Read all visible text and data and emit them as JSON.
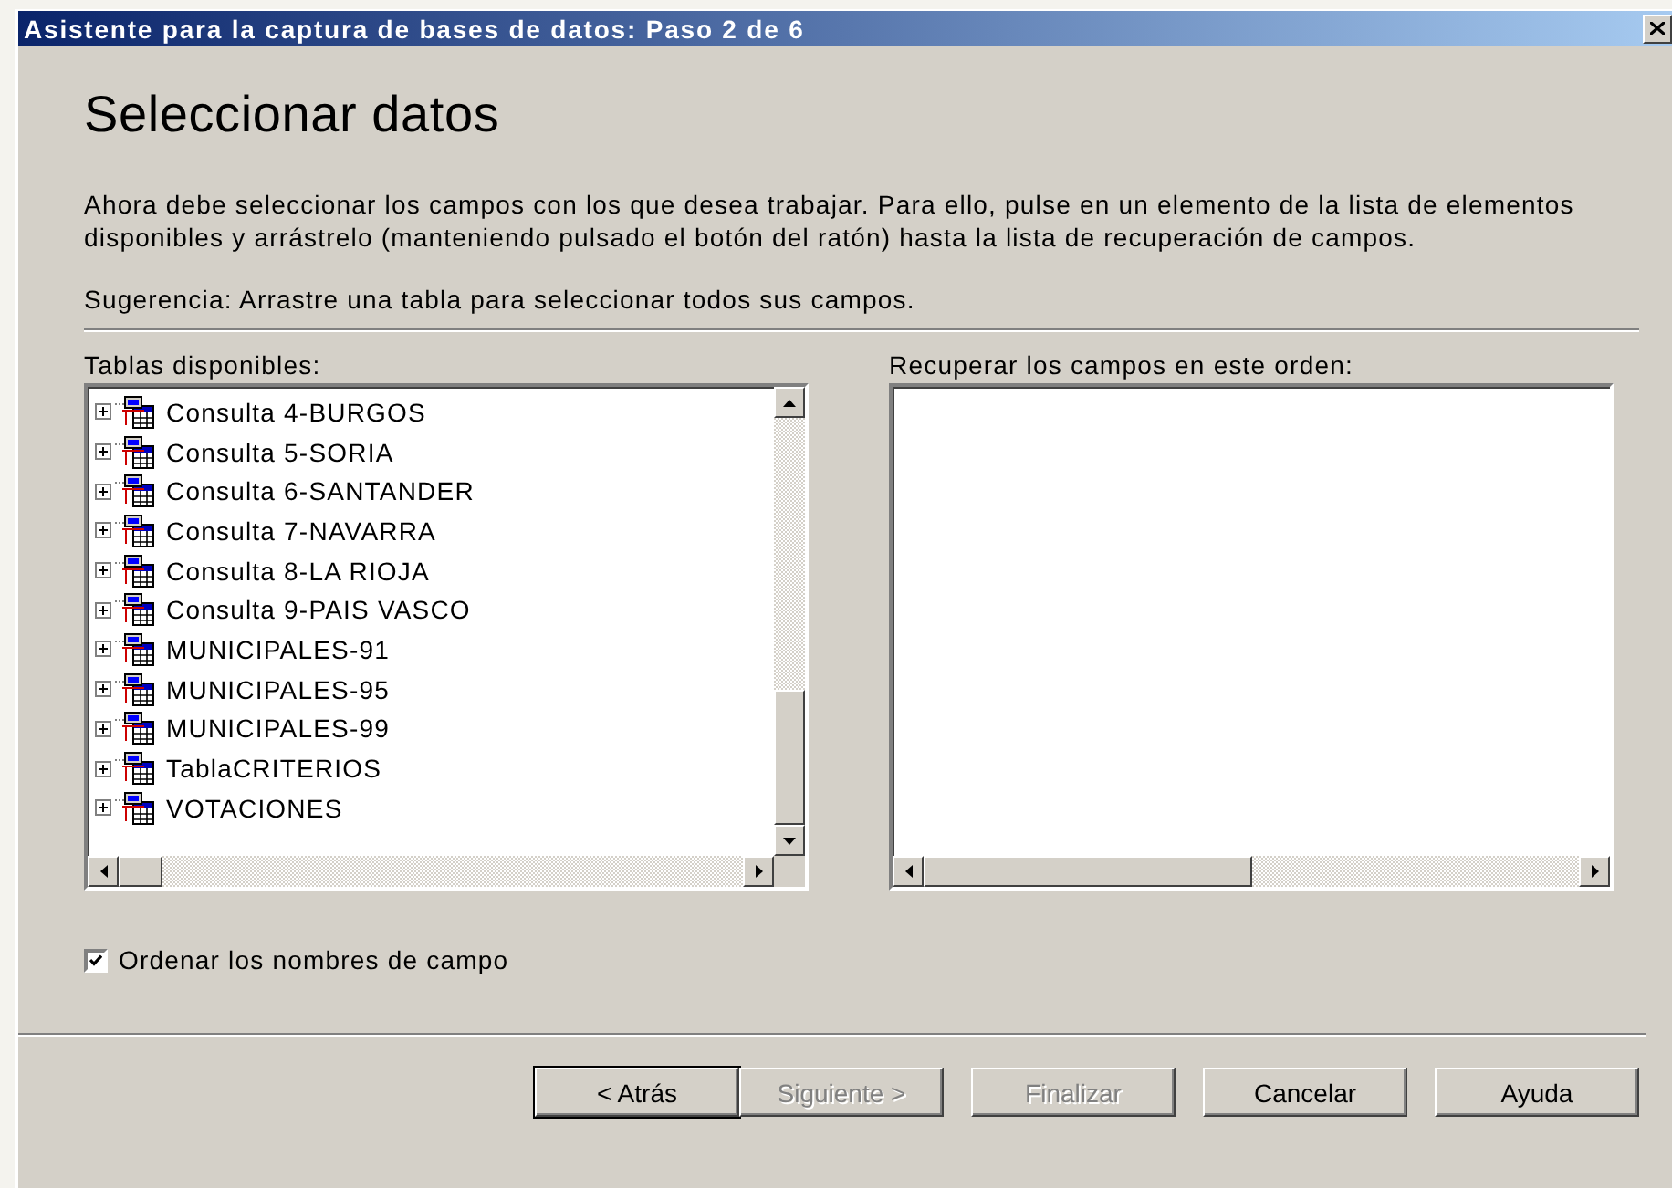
{
  "window": {
    "title": "Asistente para la captura de bases de datos: Paso 2 de 6"
  },
  "heading": "Seleccionar datos",
  "intro": "Ahora debe seleccionar los campos con los que desea trabajar. Para ello, pulse en un elemento de la lista de elementos disponibles y arrástrelo (manteniendo pulsado el botón del ratón) hasta la lista de recuperación de campos.",
  "hint": "Sugerencia: Arrastre una tabla para seleccionar todos sus campos.",
  "available_tables": {
    "label": "Tablas disponibles:",
    "items": [
      {
        "name": "Consulta 4-BURGOS",
        "expanded": false
      },
      {
        "name": "Consulta 5-SORIA",
        "expanded": false
      },
      {
        "name": "Consulta 6-SANTANDER",
        "expanded": false
      },
      {
        "name": "Consulta 7-NAVARRA",
        "expanded": false
      },
      {
        "name": "Consulta 8-LA RIOJA",
        "expanded": false
      },
      {
        "name": "Consulta 9-PAIS VASCO",
        "expanded": false
      },
      {
        "name": "MUNICIPALES-91",
        "expanded": false
      },
      {
        "name": "MUNICIPALES-95",
        "expanded": false
      },
      {
        "name": "MUNICIPALES-99",
        "expanded": false
      },
      {
        "name": "TablaCRITERIOS",
        "expanded": false
      },
      {
        "name": "VOTACIONES",
        "expanded": false
      }
    ]
  },
  "field_order": {
    "label": "Recuperar los campos en este orden:"
  },
  "sort_option": {
    "label": "Ordenar los nombres de campo",
    "checked": true
  },
  "buttons": [
    {
      "label": "< Atrás",
      "disabled": false,
      "default": true
    },
    {
      "label": "Siguiente >",
      "disabled": true,
      "default": false
    },
    {
      "label": "Finalizar",
      "disabled": true,
      "default": false
    },
    {
      "label": "Cancelar",
      "disabled": false,
      "default": false
    },
    {
      "label": "Ayuda",
      "disabled": false,
      "default": false
    }
  ]
}
